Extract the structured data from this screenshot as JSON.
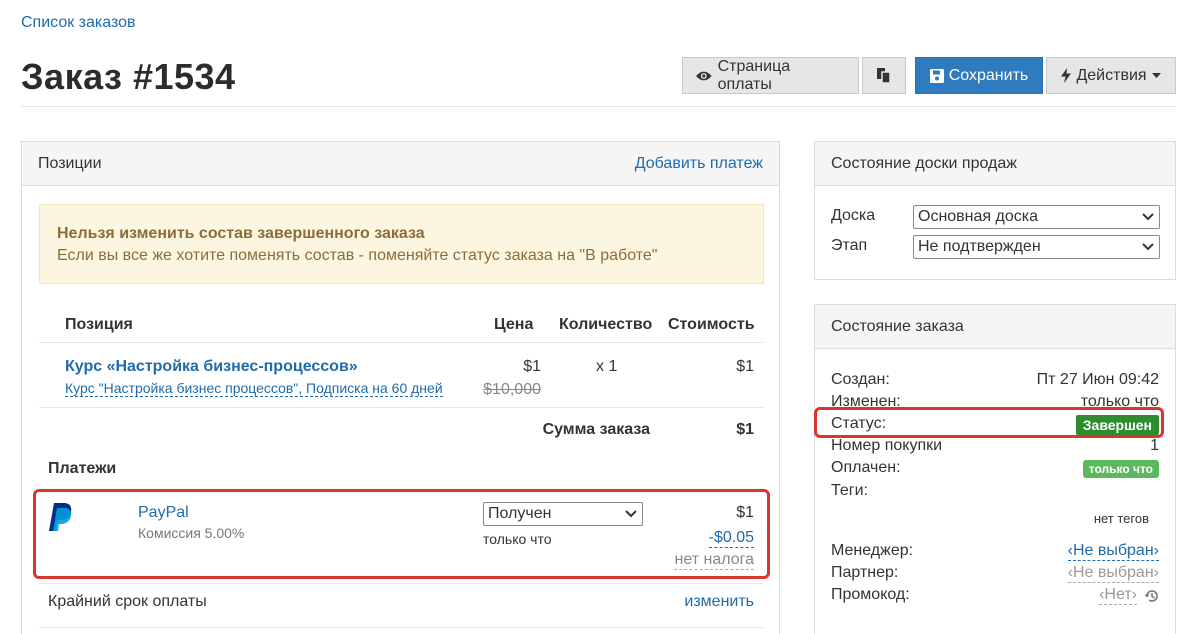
{
  "breadcrumb": "Список заказов",
  "title": "Заказ #1534",
  "toolbar": {
    "payment_page": "Страница оплаты",
    "save": "Сохранить",
    "actions": "Действия"
  },
  "positions": {
    "header": "Позиции",
    "add_payment": "Добавить платеж",
    "warning_title": "Нельзя изменить состав завершенного заказа",
    "warning_text": "Если вы все же хотите поменять состав - поменяйте статус заказа на \"В работе\"",
    "columns": {
      "item": "Позиция",
      "price": "Цена",
      "qty": "Количество",
      "cost": "Стоимость"
    },
    "item": {
      "name": "Курс «Настройка бизнес-процессов»",
      "subtitle": "Курс \"Настройка бизнес процессов\", Подписка на 60 дней",
      "price": "$1",
      "old_price": "$10,000",
      "qty": "x 1",
      "cost": "$1"
    },
    "total_label": "Сумма заказа",
    "total_value": "$1",
    "payments_header": "Платежи",
    "payment": {
      "method": "PayPal",
      "commission": "Комиссия 5.00%",
      "status": "Получен",
      "time": "только что",
      "amount": "$1",
      "fee": "-$0.05",
      "tax": "нет налога"
    },
    "deadline_label": "Крайний срок оплаты",
    "deadline_action": "изменить"
  },
  "sales_board": {
    "header": "Состояние доски продаж",
    "board_label": "Доска",
    "board_value": "Основная доска",
    "stage_label": "Этап",
    "stage_value": "Не подтвержден"
  },
  "order_state": {
    "header": "Состояние заказа",
    "created_label": "Создан:",
    "created_value": "Пт 27 Июн 09:42",
    "changed_label": "Изменен:",
    "changed_value": "только что",
    "status_label": "Статус:",
    "status_value": "Завершен",
    "purchase_label": "Номер покупки",
    "purchase_value": "1",
    "paid_label": "Оплачен:",
    "paid_value": "только что",
    "tags_label": "Теги:",
    "tags_value": "нет тегов",
    "manager_label": "Менеджер:",
    "manager_value": "Не выбран",
    "partner_label": "Партнер:",
    "partner_value": "Не выбран",
    "promo_label": "Промокод:",
    "promo_value": "Нет"
  },
  "colors": {
    "accent": "#2f7bbf",
    "link": "#1f6bab",
    "success": "#2e8b2e",
    "highlight": "#d9362f",
    "warning_bg": "#fcf6e1"
  }
}
